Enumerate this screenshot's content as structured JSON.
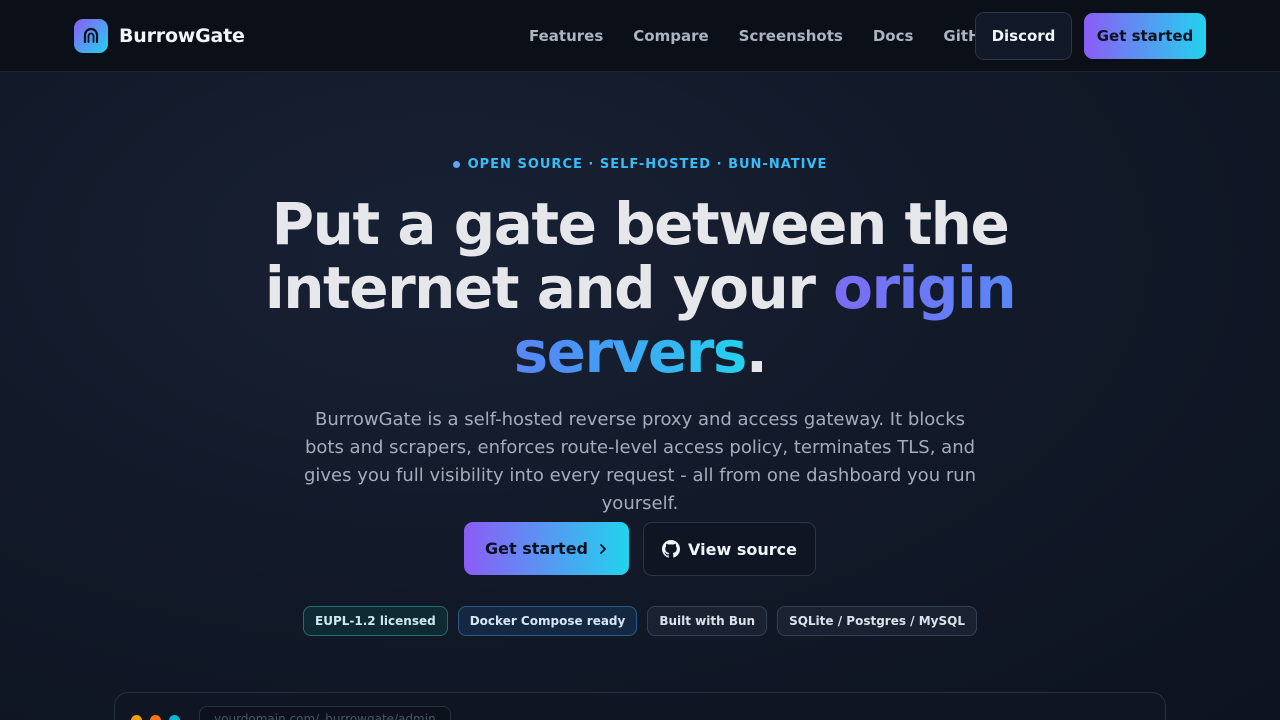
{
  "brand": {
    "name": "BurrowGate",
    "logo_icon": "tunnel-icon"
  },
  "nav": {
    "links": [
      {
        "label": "Features"
      },
      {
        "label": "Compare"
      },
      {
        "label": "Screenshots"
      },
      {
        "label": "Docs"
      },
      {
        "label": "GitHub"
      }
    ],
    "discord_label": "Discord",
    "cta_label": "Get started"
  },
  "hero": {
    "eyebrow": "OPEN SOURCE · SELF-HOSTED · BUN-NATIVE",
    "headline_part1": "Put a gate between the internet and your ",
    "headline_highlight": "origin servers",
    "headline_end": ".",
    "subtext": "BurrowGate is a self-hosted reverse proxy and access gateway. It blocks bots and scrapers, enforces route-level access policy, terminates TLS, and gives you full visibility into every request - all from one dashboard you run yourself.",
    "primary_cta": "Get started",
    "secondary_cta": "View source",
    "badges": [
      "EUPL-1.2 licensed",
      "Docker Compose ready",
      "Built with Bun",
      "SQLite / Postgres / MySQL"
    ]
  },
  "preview": {
    "url": "yourdomain.com/_burrowgate/admin",
    "dot_colors": [
      "#f59e0b",
      "#f97316",
      "#06b6d4"
    ]
  },
  "colors": {
    "accent_start": "#8b5cf6",
    "accent_end": "#22d3ee",
    "background": "#111827"
  }
}
